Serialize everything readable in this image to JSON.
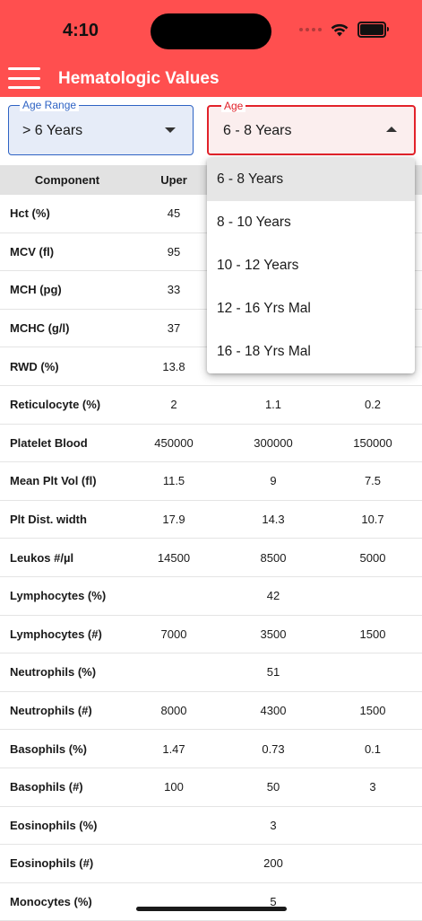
{
  "status_bar": {
    "time": "4:10"
  },
  "app_bar": {
    "title": "Hematologic Values",
    "menu_icon": "hamburger-menu-icon"
  },
  "filters": {
    "age_range": {
      "label": "Age Range",
      "value": "> 6 Years"
    },
    "age": {
      "label": "Age",
      "value": "6 - 8 Years"
    }
  },
  "age_menu": {
    "options": [
      "6 - 8 Years",
      "8 - 10 Years",
      "10 - 12 Years",
      "12 - 16 Yrs Mal",
      "16 - 18 Yrs Mal"
    ],
    "selected": "6 - 8 Years"
  },
  "table": {
    "headers": [
      "Component",
      "Uper",
      "",
      ""
    ],
    "rows": [
      [
        "Hct (%)",
        "45",
        "",
        ""
      ],
      [
        "MCV (fl)",
        "95",
        "",
        ""
      ],
      [
        "MCH (pg)",
        "33",
        "",
        ""
      ],
      [
        "MCHC (g/l)",
        "37",
        "",
        ""
      ],
      [
        "RWD (%)",
        "13.8",
        "",
        ""
      ],
      [
        "Reticulocyte (%)",
        "2",
        "1.1",
        "0.2"
      ],
      [
        "Platelet Blood",
        "450000",
        "300000",
        "150000"
      ],
      [
        "Mean Plt Vol (fl)",
        "11.5",
        "9",
        "7.5"
      ],
      [
        "Plt Dist. width",
        "17.9",
        "14.3",
        "10.7"
      ],
      [
        "Leukos #/µl",
        "14500",
        "8500",
        "5000"
      ],
      [
        "Lymphocytes (%)",
        "",
        "42",
        ""
      ],
      [
        "Lymphocytes (#)",
        "7000",
        "3500",
        "1500"
      ],
      [
        "Neutrophils (%)",
        "",
        "51",
        ""
      ],
      [
        "Neutrophils (#)",
        "8000",
        "4300",
        "1500"
      ],
      [
        "Basophils (%)",
        "1.47",
        "0.73",
        "0.1"
      ],
      [
        "Basophils (#)",
        "100",
        "50",
        "3"
      ],
      [
        "Eosinophils (%)",
        "",
        "3",
        ""
      ],
      [
        "Eosinophils (#)",
        "",
        "200",
        ""
      ],
      [
        "Monocytes (%)",
        "",
        "5",
        ""
      ]
    ]
  },
  "colors": {
    "header_red": "#ff4f4f",
    "age_range_blue": "#2e63c4",
    "age_red": "#e2222a"
  }
}
